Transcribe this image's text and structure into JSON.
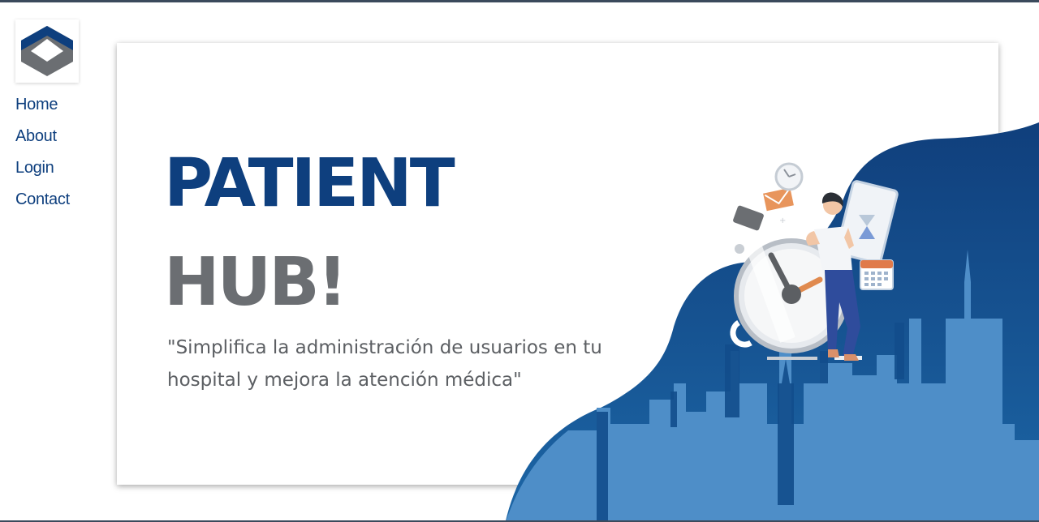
{
  "sidebar": {
    "logo_icon": "hexagon-cube-logo",
    "nav": {
      "home": "Home",
      "about": "About",
      "login": "Login",
      "contact": "Contact"
    }
  },
  "hero": {
    "title_line1": "PATIENT",
    "title_line2": "HUB!",
    "tagline": "\"Simplifica la administración de usuarios en tu hospital y mejora la atención médica\""
  },
  "illustration": {
    "icons": [
      "stopwatch-icon",
      "person-icon",
      "hourglass-phone-icon",
      "calendar-icon",
      "envelope-icon",
      "clock-icon",
      "city-skyline-icon"
    ]
  },
  "colors": {
    "brand_blue": "#0e3f7e",
    "brand_gray": "#6b6e72",
    "wave_blue": "#1a5a9c",
    "skyline_light_blue": "#4e8ec8"
  }
}
